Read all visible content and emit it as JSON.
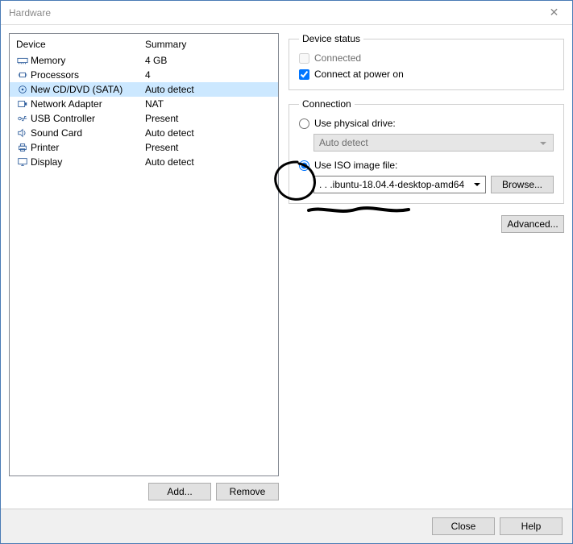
{
  "window": {
    "title": "Hardware",
    "close_glyph": "✕"
  },
  "device_list": {
    "head_device": "Device",
    "head_summary": "Summary",
    "rows": [
      {
        "icon": "memory-icon",
        "device": "Memory",
        "summary": "4 GB"
      },
      {
        "icon": "cpu-icon",
        "device": "Processors",
        "summary": "4"
      },
      {
        "icon": "cd-icon",
        "device": "New CD/DVD (SATA)",
        "summary": "Auto detect",
        "selected": true
      },
      {
        "icon": "nic-icon",
        "device": "Network Adapter",
        "summary": "NAT"
      },
      {
        "icon": "usb-icon",
        "device": "USB Controller",
        "summary": "Present"
      },
      {
        "icon": "sound-icon",
        "device": "Sound Card",
        "summary": "Auto detect"
      },
      {
        "icon": "printer-icon",
        "device": "Printer",
        "summary": "Present"
      },
      {
        "icon": "display-icon",
        "device": "Display",
        "summary": "Auto detect"
      }
    ]
  },
  "buttons": {
    "add": "Add...",
    "remove": "Remove",
    "browse": "Browse...",
    "advanced": "Advanced...",
    "close": "Close",
    "help": "Help"
  },
  "device_status": {
    "legend": "Device status",
    "connected": "Connected",
    "connect_poweron": "Connect at power on"
  },
  "connection": {
    "legend": "Connection",
    "use_physical": "Use physical drive:",
    "physical_value": "Auto detect",
    "use_iso": "Use ISO image file:",
    "iso_value": ".  .   .ibuntu-18.04.4-desktop-amd64"
  }
}
